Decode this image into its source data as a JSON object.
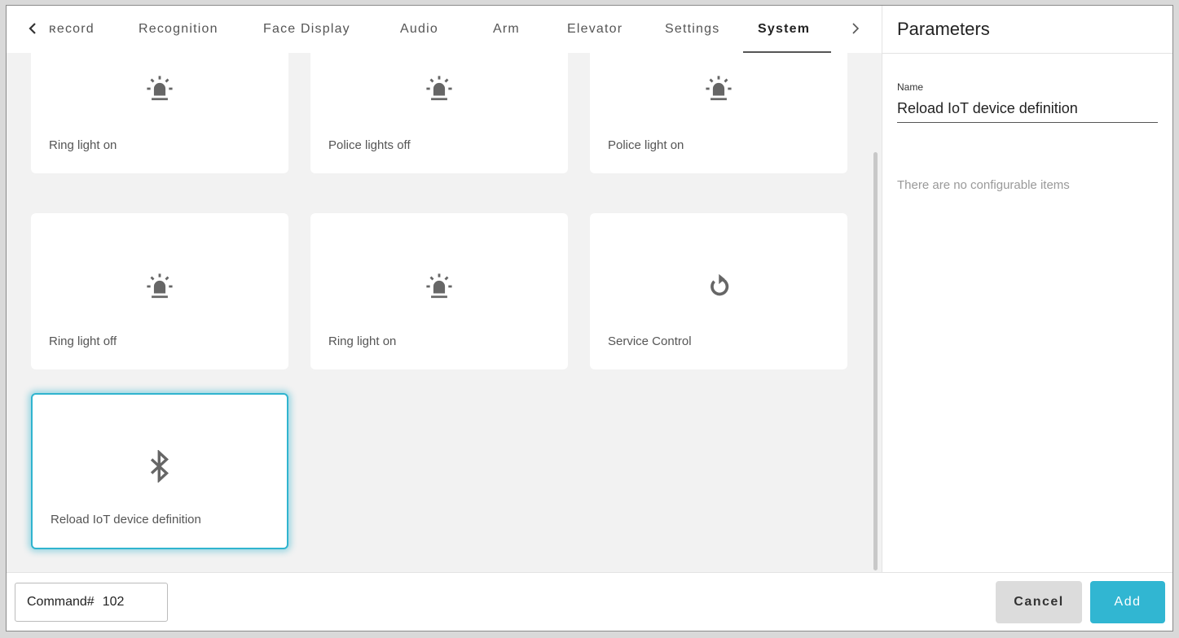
{
  "tabs": [
    {
      "label": "Record",
      "display": "ƨecord"
    },
    {
      "label": "Recognition"
    },
    {
      "label": "Face Display"
    },
    {
      "label": "Audio"
    },
    {
      "label": "Arm"
    },
    {
      "label": "Elevator"
    },
    {
      "label": "Settings"
    },
    {
      "label": "System",
      "active": true
    }
  ],
  "tab_display": {
    "t0": "ʀecord",
    "t1": "Recognition",
    "t2": "Face Display",
    "t3": "Audio",
    "t4": "Arm",
    "t5": "Elevator",
    "t6": "Settings",
    "t7": "System"
  },
  "nav": {
    "prev": "<",
    "next": ">"
  },
  "cards": [
    {
      "label": "Ring light on",
      "icon": "siren-icon"
    },
    {
      "label": "Police lights off",
      "icon": "siren-icon"
    },
    {
      "label": "Police light on",
      "icon": "siren-icon"
    },
    {
      "label": "Ring light off",
      "icon": "siren-icon"
    },
    {
      "label": "Ring light on",
      "icon": "siren-icon"
    },
    {
      "label": "Service Control",
      "icon": "restart-icon"
    },
    {
      "label": "Reload IoT device definition",
      "icon": "bluetooth-icon",
      "selected": true
    }
  ],
  "parameters": {
    "title": "Parameters",
    "name_label": "Name",
    "name_value": "Reload IoT device definition",
    "empty_message": "There are no configurable items"
  },
  "footer": {
    "command_label": "Command#",
    "command_number": "102",
    "cancel_label": "Cancel",
    "add_label": "Add"
  },
  "colors": {
    "accent": "#31b6d2",
    "selected_border": "#30b4cf",
    "icon": "#666666"
  }
}
